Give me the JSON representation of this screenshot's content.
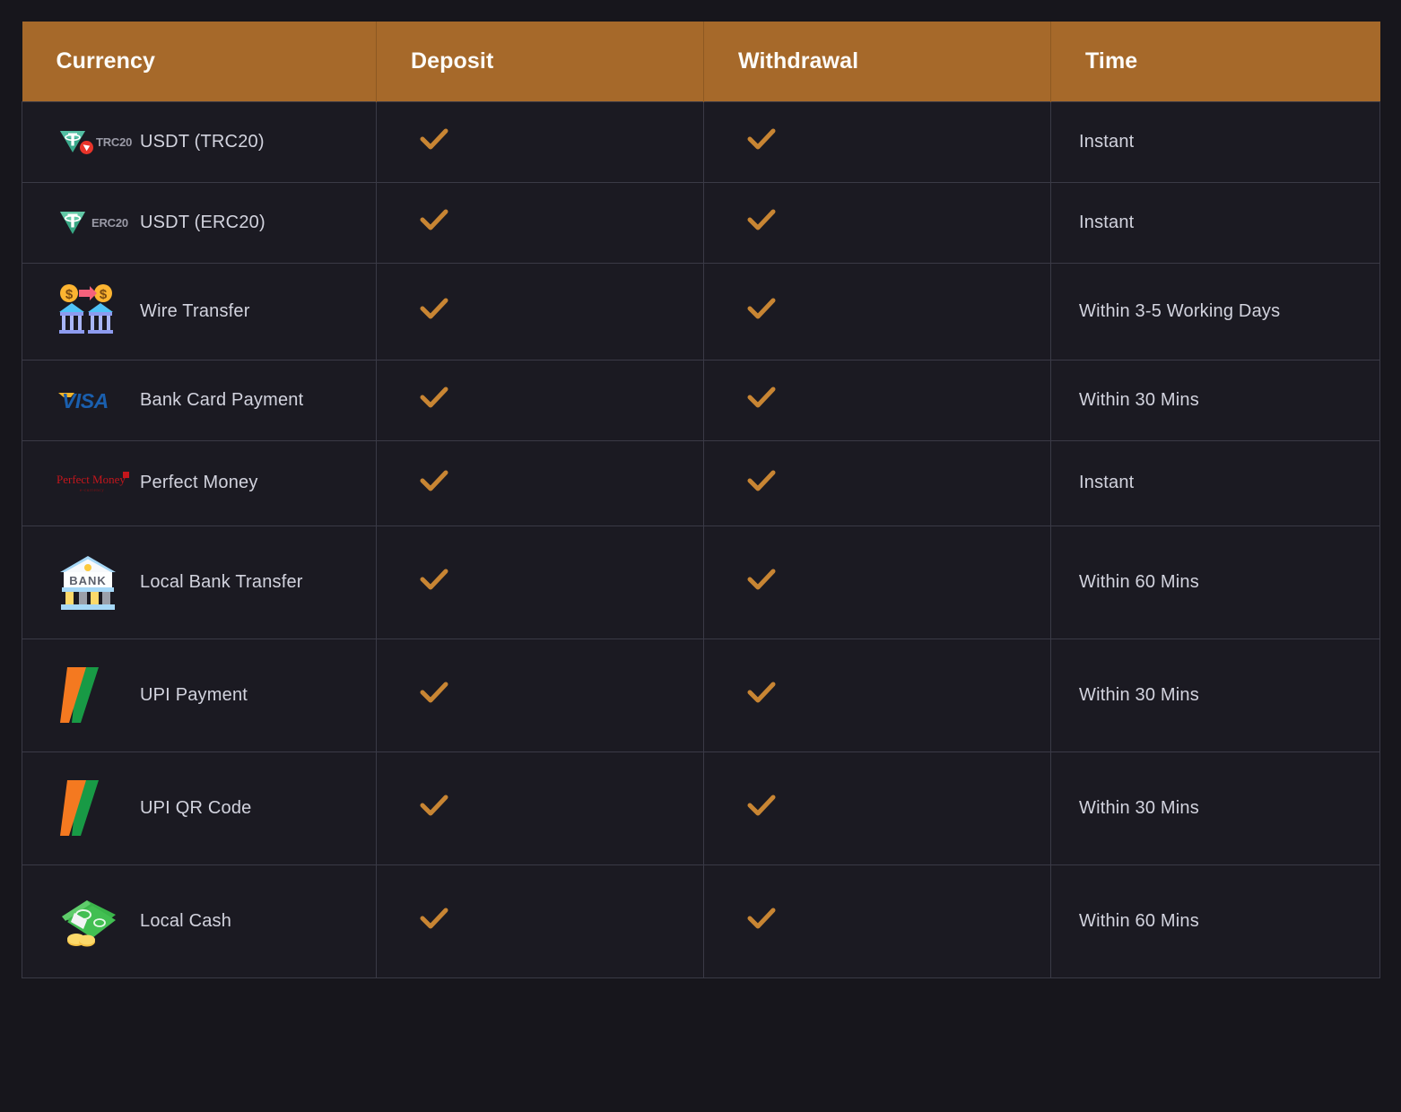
{
  "theme": {
    "page_background": "#17161c",
    "header_background": "#a6692a",
    "header_text": "#fdfcf8",
    "cell_background": "#1b1a22",
    "cell_border": "#3a3a46",
    "body_text": "#d2d3de",
    "check_color": "#c88533"
  },
  "table": {
    "columns": [
      {
        "key": "currency",
        "label": "Currency"
      },
      {
        "key": "deposit",
        "label": "Deposit"
      },
      {
        "key": "withdrawal",
        "label": "Withdrawal"
      },
      {
        "key": "time",
        "label": "Time"
      }
    ],
    "rows": [
      {
        "currency": "USDT (TRC20)",
        "logo": "tether-trc20-icon",
        "logo_badge": "TRC20",
        "deposit": true,
        "deposit_mark": "check-icon",
        "withdrawal": true,
        "withdrawal_mark": "check-icon",
        "time": "Instant"
      },
      {
        "currency": "USDT (ERC20)",
        "logo": "tether-erc20-icon",
        "logo_badge": "ERC20",
        "deposit": true,
        "deposit_mark": "check-icon",
        "withdrawal": true,
        "withdrawal_mark": "check-icon",
        "time": "Instant"
      },
      {
        "currency": "Wire Transfer",
        "logo": "wire-transfer-icon",
        "logo_badge": "",
        "deposit": true,
        "deposit_mark": "check-icon",
        "withdrawal": true,
        "withdrawal_mark": "check-icon",
        "time": "Within 3-5 Working Days"
      },
      {
        "currency": "Bank Card Payment",
        "logo": "visa-icon",
        "logo_badge": "",
        "deposit": true,
        "deposit_mark": "check-icon",
        "withdrawal": true,
        "withdrawal_mark": "check-icon",
        "time": "Within 30 Mins"
      },
      {
        "currency": "Perfect Money",
        "logo": "perfect-money-icon",
        "logo_badge": "",
        "deposit": true,
        "deposit_mark": "check-icon",
        "withdrawal": true,
        "withdrawal_mark": "check-icon",
        "time": "Instant"
      },
      {
        "currency": "Local Bank Transfer",
        "logo": "bank-icon",
        "logo_badge": "BANK",
        "deposit": true,
        "deposit_mark": "check-icon",
        "withdrawal": true,
        "withdrawal_mark": "check-icon",
        "time": "Within 60 Mins"
      },
      {
        "currency": "UPI Payment",
        "logo": "upi-icon",
        "logo_badge": "",
        "deposit": true,
        "deposit_mark": "check-icon",
        "withdrawal": true,
        "withdrawal_mark": "check-icon",
        "time": "Within 30 Mins"
      },
      {
        "currency": "UPI QR Code",
        "logo": "upi-icon",
        "logo_badge": "",
        "deposit": true,
        "deposit_mark": "check-icon",
        "withdrawal": true,
        "withdrawal_mark": "check-icon",
        "time": "Within 30 Mins"
      },
      {
        "currency": "Local Cash",
        "logo": "money-icon",
        "logo_badge": "",
        "deposit": true,
        "deposit_mark": "check-icon",
        "withdrawal": true,
        "withdrawal_mark": "check-icon",
        "time": "Within 60 Mins"
      }
    ]
  }
}
